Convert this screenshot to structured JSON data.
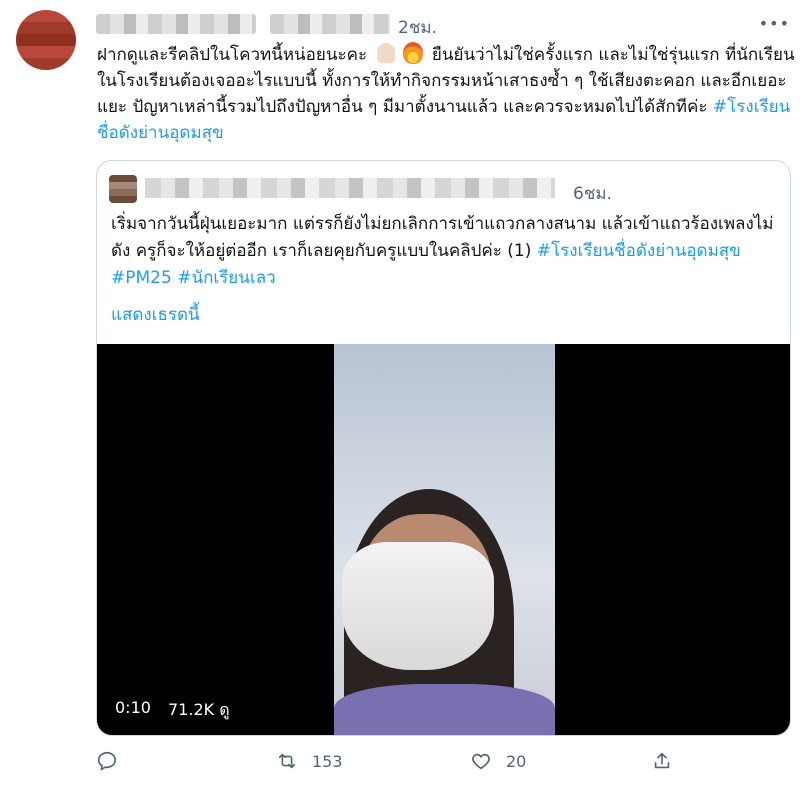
{
  "tweet": {
    "time": "2ชม.",
    "text_line1": "ฝากดูและรีคลิปในโควทนี้หน่อยนะคะ ",
    "text_line1b": " ยืนยันว่าไม่ใช่ครั้งแรก และไม่ใช่รุ่นแรก",
    "text_rest": "ที่นักเรียนในโรงเรียนต้องเจออะไรแบบนี้ ทั้งการให้ทำกิจกรรมหน้าเสาธงซ้ำ ๆ ใช้เสียงตะคอก และอีกเยอะแยะ ปัญหาเหล่านี้รวมไปถึงปัญหาอื่น ๆ มีมาตั้งนานแล้ว และควรจะหมดไปได้สักทีค่ะ ",
    "hashtag": "#โรงเรียนชื่อดังย่านอุดมสุข",
    "more_icon": "more-horizontal-icon"
  },
  "quote": {
    "time": "6ชม.",
    "text": "เริ่มจากวันนี้ฝุ่นเยอะมาก แต่รรก็ยังไม่ยกเลิกการเข้าแถวกลางสนาม แล้วเข้าแถวร้องเพลงไม่ดัง ครูก็จะให้อยู่ต่ออีก เราก็เลยคุยกับครูแบบในคลิปค่ะ (1) ",
    "hashtags": [
      "#โรงเรียนชื่อดังย่านอุดมสุข",
      "#PM25",
      "#นักเรียนเลว"
    ],
    "show_thread": "แสดงเธรดนี้",
    "video": {
      "duration": "0:10",
      "views": "71.2K ดู"
    }
  },
  "actions": {
    "reply_icon": "reply-icon",
    "retweet_icon": "retweet-icon",
    "retweet_count": "153",
    "like_icon": "heart-icon",
    "like_count": "20",
    "share_icon": "share-icon"
  },
  "colors": {
    "accent": "#1d9bf0",
    "secondary_text": "#536471",
    "border": "#cfd9de"
  }
}
